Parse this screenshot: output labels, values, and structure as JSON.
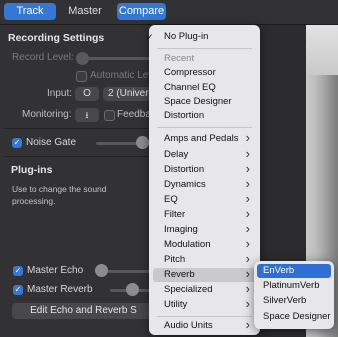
{
  "tabs": {
    "track": "Track",
    "master": "Master",
    "compare": "Compare"
  },
  "recording": {
    "title": "Recording Settings",
    "record_level_label": "Record Level:",
    "auto_level_label": "Automatic Lev",
    "input_label": "Input:",
    "input_icon_value": "O",
    "input_value": "2  (Univer",
    "monitoring_label": "Monitoring:",
    "feedback_label": "Feedba"
  },
  "noise_gate": {
    "label": "Noise Gate",
    "checked": true
  },
  "plugins": {
    "title": "Plug-ins",
    "description": "Use to change the sound processing."
  },
  "master_echo": {
    "label": "Master Echo",
    "checked": true
  },
  "master_reverb": {
    "label": "Master Reverb",
    "checked": true
  },
  "edit_button": "Edit Echo and Reverb S",
  "menu": {
    "no_plugin": "No Plug-in",
    "checkmark": "✓",
    "recent_header": "Recent",
    "recent": [
      "Compressor",
      "Channel EQ",
      "Space Designer",
      "Distortion"
    ],
    "categories": [
      "Amps and Pedals",
      "Delay",
      "Distortion",
      "Dynamics",
      "EQ",
      "Filter",
      "Imaging",
      "Modulation",
      "Pitch",
      "Reverb",
      "Specialized",
      "Utility"
    ],
    "highlighted": "Reverb",
    "audio_units": "Audio Units"
  },
  "submenu": {
    "items": [
      "EnVerb",
      "PlatinumVerb",
      "SilverVerb",
      "Space Designer"
    ],
    "selected": "EnVerb"
  },
  "colors": {
    "accent": "#3478d4",
    "panel": "#323234",
    "menu": "#e7e7e9"
  }
}
